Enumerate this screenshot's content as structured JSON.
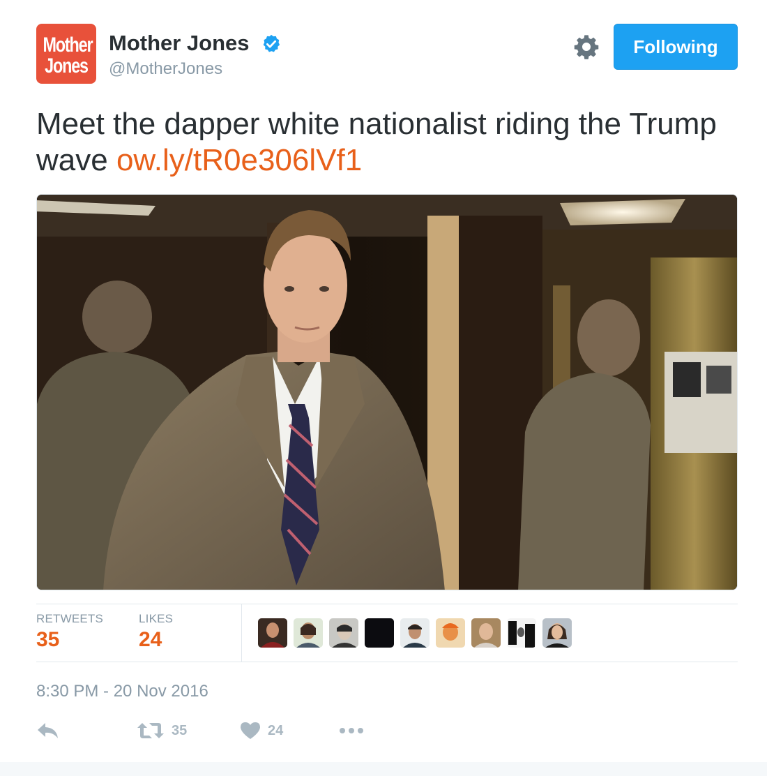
{
  "account": {
    "name": "Mother Jones",
    "handle": "@MotherJones",
    "logo_line1": "Mother",
    "logo_line2": "Jones",
    "verified": true
  },
  "header": {
    "settings_icon": "gear-icon",
    "follow_label": "Following"
  },
  "tweet": {
    "text": "Meet the dapper white nationalist riding the Trump wave ",
    "link": "ow.ly/tR0e306lVf1"
  },
  "stats": {
    "retweets_label": "RETWEETS",
    "retweets_count": "35",
    "likes_label": "LIKES",
    "likes_count": "24"
  },
  "timestamp": "8:30 PM - 20 Nov 2016",
  "actions": {
    "reply_icon": "reply-icon",
    "retweet_icon": "retweet-icon",
    "retweet_count": "35",
    "like_icon": "heart-icon",
    "like_count": "24",
    "more_icon": "more-icon"
  },
  "colors": {
    "accent_orange": "#e8601a",
    "follow_blue": "#1da1f2",
    "logo_red": "#e8513a",
    "muted": "#8899a6"
  }
}
